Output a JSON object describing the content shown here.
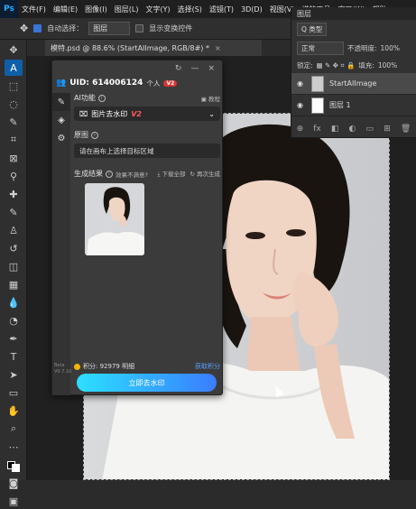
{
  "menubar": {
    "logo": "Ps",
    "items": [
      "文件(F)",
      "编辑(E)",
      "图像(I)",
      "图层(L)",
      "文字(Y)",
      "选择(S)",
      "滤镜(T)",
      "3D(D)",
      "视图(V)",
      "增效工具",
      "窗口(W)",
      "帮助"
    ]
  },
  "options": {
    "auto_select_label": "自动选择：",
    "auto_select_value": "图层",
    "transform_label": "显示变换控件"
  },
  "document": {
    "tab_title": "模特.psd @ 88.6% (StartAIImage, RGB/8#) *"
  },
  "layers_panel": {
    "title": "图层",
    "kind_select": "Q 类型",
    "blend_mode": "正常",
    "opacity_label": "不透明度:",
    "opacity_value": "100%",
    "lock_label": "锁定:",
    "fill_label": "填充:",
    "fill_value": "100%",
    "layers": [
      {
        "name": "StartAIImage",
        "selected": true
      },
      {
        "name": "图层 1",
        "selected": false
      }
    ],
    "footer_icons": [
      "⊕",
      "fx",
      "◧",
      "◐",
      "▭",
      "⊞",
      "🗑"
    ]
  },
  "plugin": {
    "uid_text": "UID: 614006124",
    "account_type": "个人",
    "vip_badge": "V2",
    "ai_function_label": "AI功能",
    "tutorial_label": "教程",
    "feature_select": "图片去水印",
    "feature_version": "V2",
    "original_label": "原图",
    "original_placeholder": "请在画布上选择目标区域",
    "result_label": "生成结果",
    "result_feedback": "效果不满意?",
    "download_all": "下载全部",
    "regenerate": "再次生成",
    "credits_text": "积分: 92979 明细",
    "get_credits": "获取积分",
    "version_text": "Beta V0.7.10",
    "main_button": "立即去水印"
  }
}
